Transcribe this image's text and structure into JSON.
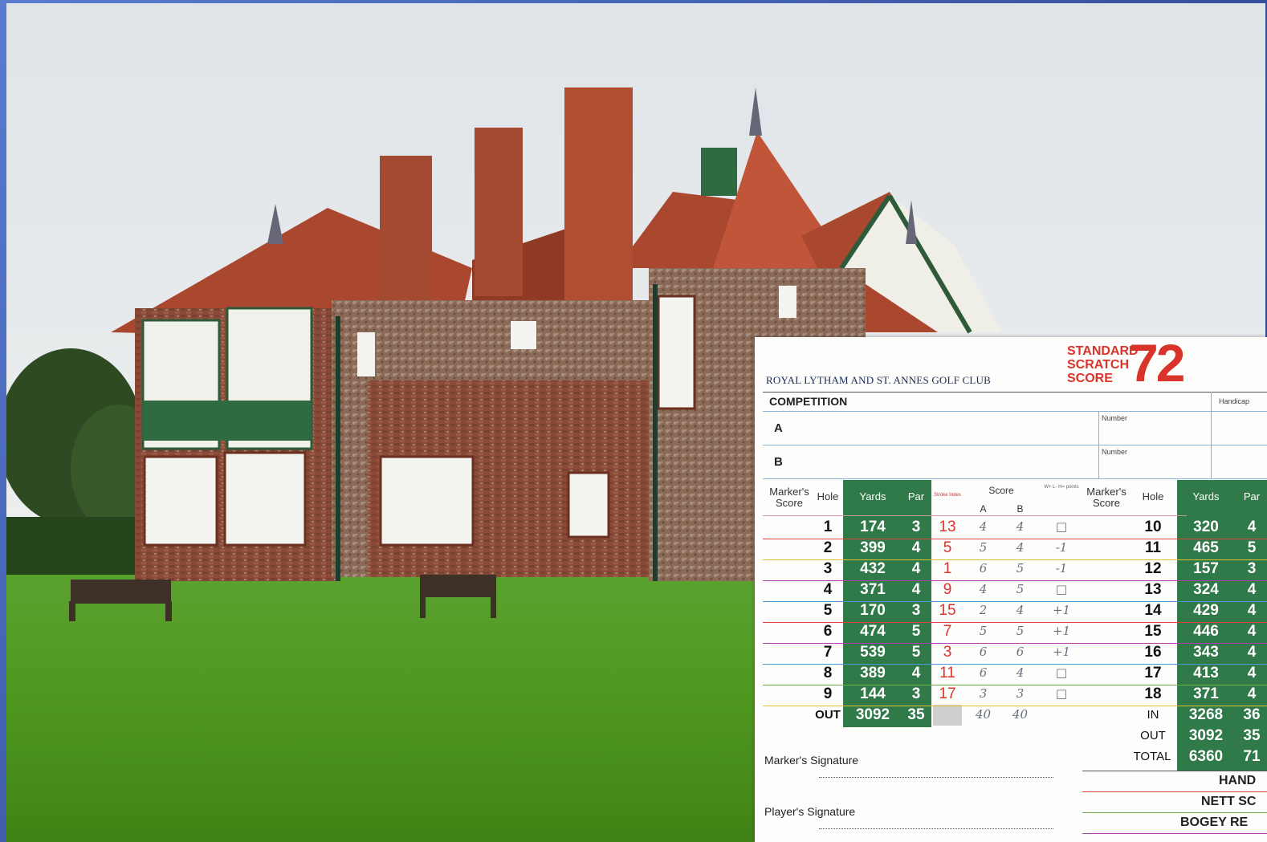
{
  "scorecard": {
    "club_name": "ROYAL LYTHAM AND ST. ANNES GOLF CLUB",
    "sss_label": [
      "STANDARD",
      "SCRATCH",
      "SCORE"
    ],
    "sss_value": "72",
    "competition_label": "COMPETITION",
    "handicap_label": "Handicap",
    "player_a": "A",
    "player_b": "B",
    "number_label": "Number",
    "headers": {
      "markers_score": "Marker's Score",
      "hole": "Hole",
      "yards": "Yards",
      "par": "Par",
      "stroke_index": "Stroke Index",
      "score": "Score",
      "score_a": "A",
      "score_b": "B",
      "points": "W+ L- H= points"
    },
    "front_nine": [
      {
        "hole": "1",
        "yards": "174",
        "par": "3",
        "si": "13",
        "a": "4",
        "b": "4",
        "pts": "□"
      },
      {
        "hole": "2",
        "yards": "399",
        "par": "4",
        "si": "5",
        "a": "5",
        "b": "4",
        "pts": "-1"
      },
      {
        "hole": "3",
        "yards": "432",
        "par": "4",
        "si": "1",
        "a": "6",
        "b": "5",
        "pts": "-1"
      },
      {
        "hole": "4",
        "yards": "371",
        "par": "4",
        "si": "9",
        "a": "4",
        "b": "5",
        "pts": "□"
      },
      {
        "hole": "5",
        "yards": "170",
        "par": "3",
        "si": "15",
        "a": "2",
        "b": "4",
        "pts": "+1"
      },
      {
        "hole": "6",
        "yards": "474",
        "par": "5",
        "si": "7",
        "a": "5",
        "b": "5",
        "pts": "+1"
      },
      {
        "hole": "7",
        "yards": "539",
        "par": "5",
        "si": "3",
        "a": "6",
        "b": "6",
        "pts": "+1"
      },
      {
        "hole": "8",
        "yards": "389",
        "par": "4",
        "si": "11",
        "a": "6",
        "b": "4",
        "pts": "□"
      },
      {
        "hole": "9",
        "yards": "144",
        "par": "3",
        "si": "17",
        "a": "3",
        "b": "3",
        "pts": "□"
      }
    ],
    "out_row": {
      "label": "OUT",
      "yards": "3092",
      "par": "35",
      "a": "40",
      "b": "40"
    },
    "back_nine": [
      {
        "hole": "10",
        "yards": "320",
        "par": "4"
      },
      {
        "hole": "11",
        "yards": "465",
        "par": "5"
      },
      {
        "hole": "12",
        "yards": "157",
        "par": "3"
      },
      {
        "hole": "13",
        "yards": "324",
        "par": "4"
      },
      {
        "hole": "14",
        "yards": "429",
        "par": "4"
      },
      {
        "hole": "15",
        "yards": "446",
        "par": "4"
      },
      {
        "hole": "16",
        "yards": "343",
        "par": "4"
      },
      {
        "hole": "17",
        "yards": "413",
        "par": "4"
      },
      {
        "hole": "18",
        "yards": "371",
        "par": "4"
      }
    ],
    "in_row": {
      "label": "IN",
      "yards": "3268",
      "par": "36"
    },
    "out_total_row": {
      "label": "OUT",
      "yards": "3092",
      "par": "35"
    },
    "total_row": {
      "label": "TOTAL",
      "yards": "6360",
      "par": "71"
    },
    "markers_signature": "Marker's Signature",
    "players_signature": "Player's Signature",
    "handicap_footer": "HAND",
    "nett_footer": "NETT SC",
    "bogey_footer": "BOGEY RE"
  }
}
